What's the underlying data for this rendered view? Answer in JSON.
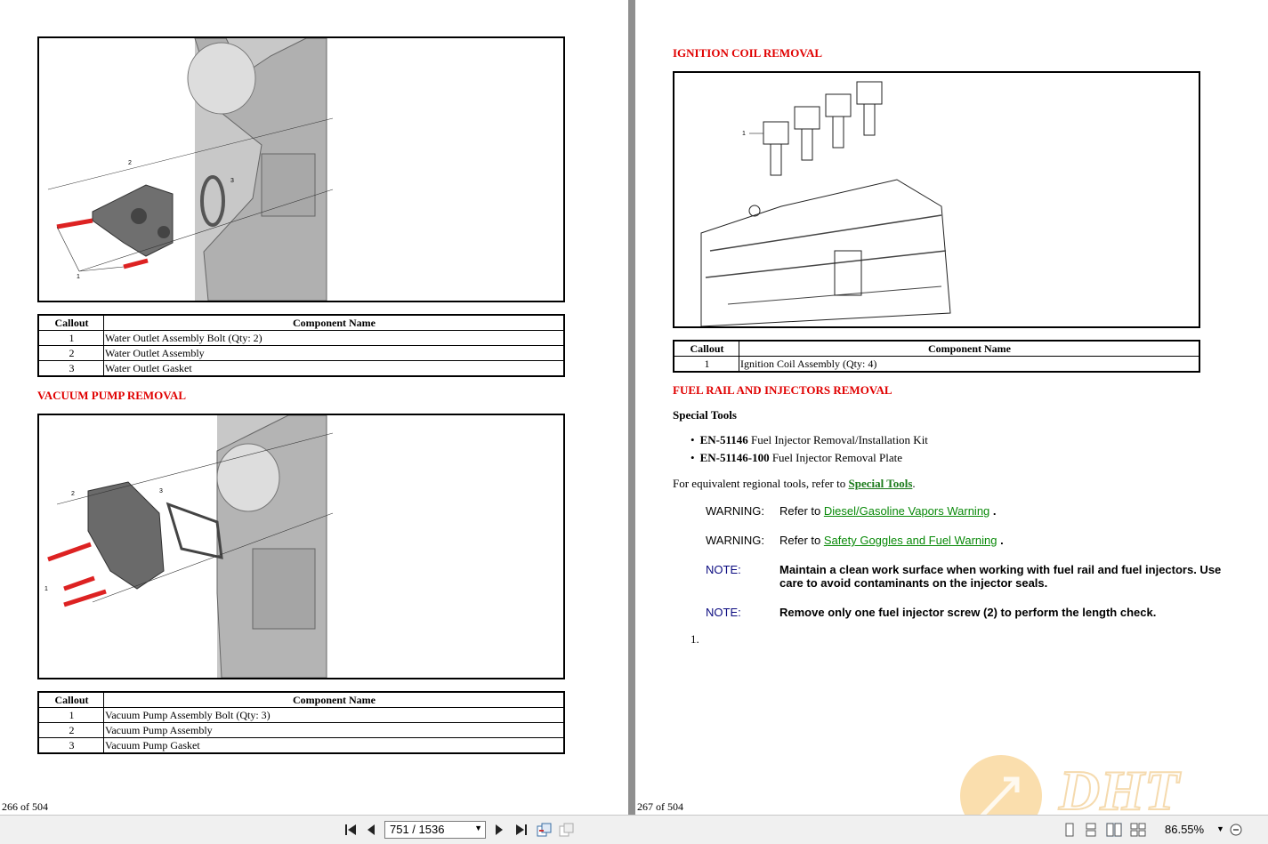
{
  "left_page": {
    "figure1_callouts": [
      "1",
      "2",
      "3"
    ],
    "table1": {
      "headers": [
        "Callout",
        "Component Name"
      ],
      "rows": [
        [
          "1",
          "Water Outlet Assembly Bolt (Qty: 2)"
        ],
        [
          "2",
          "Water Outlet Assembly"
        ],
        [
          "3",
          "Water Outlet Gasket"
        ]
      ]
    },
    "heading2": "VACUUM PUMP REMOVAL",
    "figure2_callouts": [
      "1",
      "2",
      "3"
    ],
    "table2": {
      "headers": [
        "Callout",
        "Component Name"
      ],
      "rows": [
        [
          "1",
          "Vacuum Pump Assembly Bolt (Qty: 3)"
        ],
        [
          "2",
          "Vacuum Pump Assembly"
        ],
        [
          "3",
          "Vacuum Pump Gasket"
        ]
      ]
    },
    "page_number": "266 of 504"
  },
  "right_page": {
    "heading1": "IGNITION COIL REMOVAL",
    "figure_callouts": [
      "1"
    ],
    "table1": {
      "headers": [
        "Callout",
        "Component Name"
      ],
      "rows": [
        [
          "1",
          "Ignition Coil Assembly (Qty: 4)"
        ]
      ]
    },
    "heading2": "FUEL RAIL AND INJECTORS REMOVAL",
    "special_tools_label": "Special Tools",
    "tools": [
      {
        "code": "EN-51146",
        "desc": " Fuel Injector Removal/Installation Kit"
      },
      {
        "code": "EN-51146-100",
        "desc": " Fuel Injector Removal Plate"
      }
    ],
    "regional_text": "For equivalent regional tools, refer to ",
    "regional_link": "Special Tools",
    "regional_end": ".",
    "warnings": [
      {
        "label": "WARNING:",
        "prefix": "Refer to ",
        "link": "Diesel/Gasoline Vapors Warning",
        "suffix": " ."
      },
      {
        "label": "WARNING:",
        "prefix": "Refer to ",
        "link": "Safety Goggles and Fuel Warning",
        "suffix": " ."
      }
    ],
    "notes": [
      {
        "label": "NOTE:",
        "text": "Maintain a clean work surface when working with fuel rail and fuel injectors. Use care to avoid contaminants on the injector seals."
      },
      {
        "label": "NOTE:",
        "text": "Remove only one fuel injector screw (2) to perform the length check."
      }
    ],
    "step_number": "1.",
    "page_number": "267 of 504"
  },
  "toolbar": {
    "page_field": "751 / 1536",
    "zoom": "86.55%"
  },
  "colors": {
    "heading_red": "#e00000",
    "link_green": "#1a7a1a",
    "note_navy": "#0a0a80"
  }
}
